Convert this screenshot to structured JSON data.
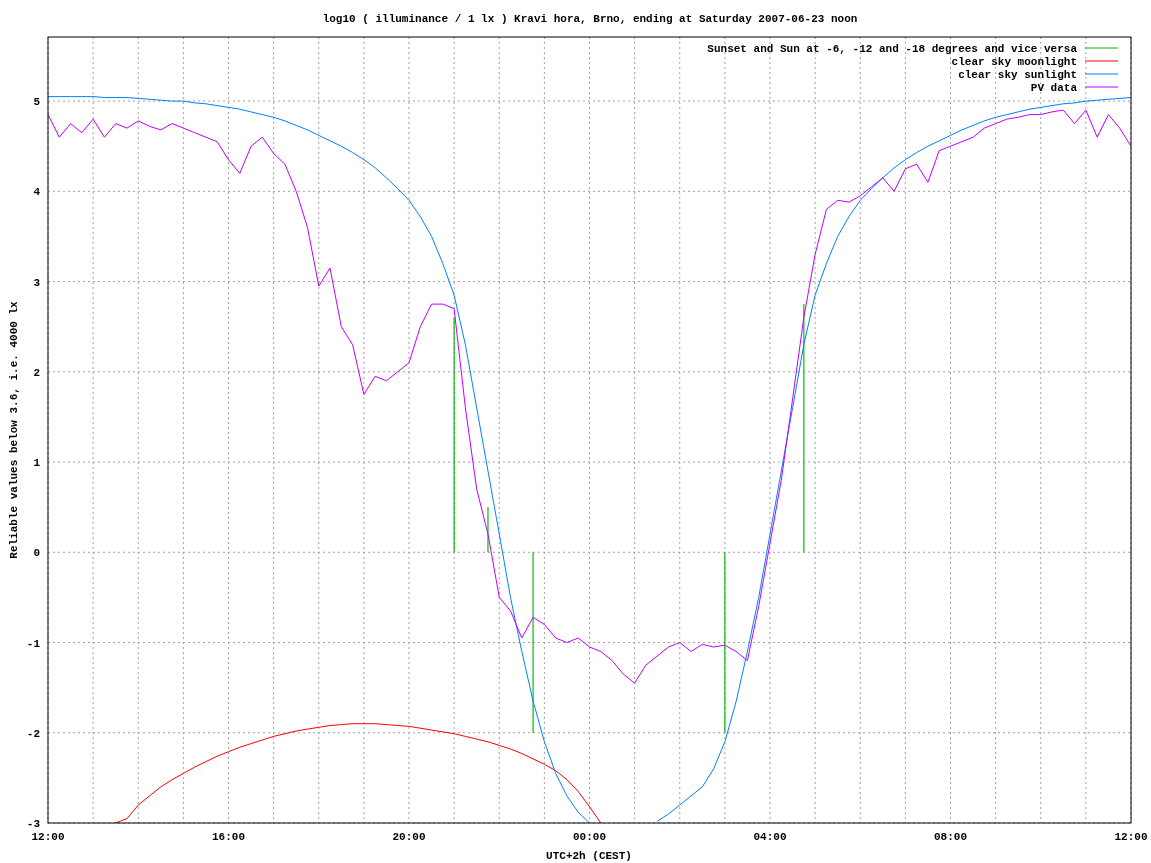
{
  "chart_data": {
    "type": "line",
    "title": "log10 ( illuminance / 1 lx ) Kravi hora, Brno, ending at Saturday 2007-06-23 noon",
    "xlabel": "UTC+2h (CEST)",
    "ylabel": "Reliable values below 3.6, i.e. 4000 lx",
    "ylim": [
      -3,
      5.71
    ],
    "grid": true,
    "legend": "upper right",
    "yticks": [
      -3,
      -2,
      -1,
      0,
      1,
      2,
      3,
      4,
      5
    ],
    "categories": [
      "12:00",
      null,
      null,
      null,
      null,
      null,
      null,
      null,
      null,
      null,
      null,
      null,
      null,
      null,
      null,
      null,
      "16:00",
      null,
      null,
      null,
      null,
      null,
      null,
      null,
      null,
      null,
      null,
      null,
      null,
      null,
      null,
      null,
      "20:00",
      null,
      null,
      null,
      null,
      null,
      null,
      null,
      null,
      null,
      null,
      null,
      null,
      null,
      null,
      null,
      "00:00",
      null,
      null,
      null,
      null,
      null,
      null,
      null,
      null,
      null,
      null,
      null,
      null,
      null,
      null,
      null,
      "04:00",
      null,
      null,
      null,
      null,
      null,
      null,
      null,
      null,
      null,
      null,
      null,
      null,
      null,
      null,
      null,
      "08:00",
      null,
      null,
      null,
      null,
      null,
      null,
      null,
      null,
      null,
      null,
      null,
      null,
      null,
      null,
      null,
      "12:00"
    ],
    "series": [
      {
        "name": "Sunset and Sun at -6, -12 and -18 degrees and vice versa",
        "color": "#00c000",
        "type": "bar",
        "values": [
          null,
          null,
          null,
          null,
          null,
          null,
          null,
          null,
          null,
          null,
          null,
          null,
          null,
          null,
          null,
          null,
          null,
          null,
          null,
          null,
          null,
          null,
          null,
          null,
          null,
          null,
          null,
          null,
          null,
          null,
          null,
          null,
          null,
          null,
          null,
          null,
          2.6,
          null,
          null,
          0.5,
          null,
          null,
          null,
          -2.0,
          null,
          null,
          null,
          null,
          null,
          null,
          null,
          null,
          null,
          null,
          null,
          null,
          null,
          null,
          null,
          null,
          -2.0,
          null,
          null,
          null,
          null,
          null,
          null,
          2.75,
          null,
          null,
          null,
          null,
          null,
          null,
          null,
          null,
          null,
          null,
          null,
          null,
          null,
          null,
          null,
          null,
          null,
          null,
          null,
          null,
          null,
          null,
          null,
          null,
          null,
          null,
          null,
          null,
          null
        ]
      },
      {
        "name": "clear sky moonlight",
        "color": "#ff0000",
        "type": "line",
        "values": [
          null,
          null,
          null,
          null,
          null,
          null,
          -3.0,
          -2.95,
          -2.8,
          -2.7,
          -2.6,
          -2.52,
          -2.45,
          -2.38,
          -2.32,
          -2.26,
          -2.21,
          -2.16,
          -2.12,
          -2.08,
          -2.04,
          -2.01,
          -1.98,
          -1.96,
          -1.94,
          -1.92,
          -1.91,
          -1.9,
          -1.9,
          -1.9,
          -1.91,
          -1.92,
          -1.93,
          -1.95,
          -1.97,
          -1.99,
          -2.01,
          -2.04,
          -2.07,
          -2.1,
          -2.14,
          -2.18,
          -2.23,
          -2.29,
          -2.35,
          -2.42,
          -2.52,
          -2.65,
          -2.82,
          -3.0,
          null,
          null,
          null,
          null,
          null,
          null,
          null,
          null,
          null,
          null,
          null,
          null,
          null,
          null,
          null,
          null,
          null,
          null,
          null,
          null,
          null,
          null,
          null,
          null,
          null,
          null,
          null,
          null,
          null,
          null,
          null,
          null,
          null,
          null,
          null,
          null,
          null,
          null,
          null,
          null,
          null,
          null,
          null,
          null,
          null,
          null,
          null
        ]
      },
      {
        "name": "clear sky sunlight",
        "color": "#0080ff",
        "type": "line",
        "values": [
          5.05,
          5.05,
          5.05,
          5.05,
          5.05,
          5.04,
          5.04,
          5.04,
          5.03,
          5.02,
          5.01,
          5.0,
          5.0,
          4.98,
          4.97,
          4.95,
          4.93,
          4.91,
          4.88,
          4.85,
          4.82,
          4.78,
          4.73,
          4.68,
          4.62,
          4.56,
          4.5,
          4.43,
          4.35,
          4.26,
          4.15,
          4.03,
          3.9,
          3.72,
          3.5,
          3.2,
          2.85,
          2.3,
          1.6,
          0.9,
          0.2,
          -0.5,
          -1.1,
          -1.65,
          -2.1,
          -2.45,
          -2.7,
          -2.88,
          -3.0,
          null,
          null,
          null,
          null,
          null,
          -2.98,
          -2.9,
          -2.8,
          -2.7,
          -2.6,
          -2.4,
          -2.1,
          -1.65,
          -1.1,
          -0.5,
          0.2,
          0.9,
          1.6,
          2.3,
          2.85,
          3.2,
          3.5,
          3.72,
          3.9,
          4.03,
          4.15,
          4.26,
          4.35,
          4.43,
          4.5,
          4.56,
          4.62,
          4.68,
          4.73,
          4.78,
          4.82,
          4.85,
          4.88,
          4.91,
          4.93,
          4.95,
          4.97,
          4.98,
          5.0,
          5.01,
          5.02,
          5.03,
          5.04
        ]
      },
      {
        "name": "PV data",
        "color": "#c000ff",
        "type": "line",
        "values": [
          4.85,
          4.6,
          4.75,
          4.65,
          4.8,
          4.6,
          4.75,
          4.7,
          4.78,
          4.72,
          4.68,
          4.75,
          4.7,
          4.65,
          4.6,
          4.55,
          4.35,
          4.2,
          4.5,
          4.6,
          4.42,
          4.3,
          4.0,
          3.6,
          2.95,
          3.15,
          2.5,
          2.3,
          1.75,
          1.95,
          1.9,
          2.0,
          2.1,
          2.5,
          2.75,
          2.75,
          2.7,
          1.6,
          0.7,
          0.2,
          -0.5,
          -0.65,
          -0.95,
          -0.72,
          -0.8,
          -0.95,
          -1.0,
          -0.95,
          -1.05,
          -1.1,
          -1.2,
          -1.35,
          -1.45,
          -1.25,
          -1.15,
          -1.05,
          -1.0,
          -1.1,
          -1.02,
          -1.05,
          -1.03,
          -1.1,
          -1.2,
          -0.6,
          0.1,
          0.8,
          1.7,
          2.6,
          3.3,
          3.8,
          3.9,
          3.88,
          3.95,
          4.05,
          4.15,
          4.0,
          4.25,
          4.3,
          4.1,
          4.45,
          4.5,
          4.55,
          4.6,
          4.7,
          4.75,
          4.8,
          4.82,
          4.85,
          4.85,
          4.88,
          4.9,
          4.75,
          4.9,
          4.6,
          4.85,
          4.7,
          4.5
        ]
      }
    ]
  }
}
